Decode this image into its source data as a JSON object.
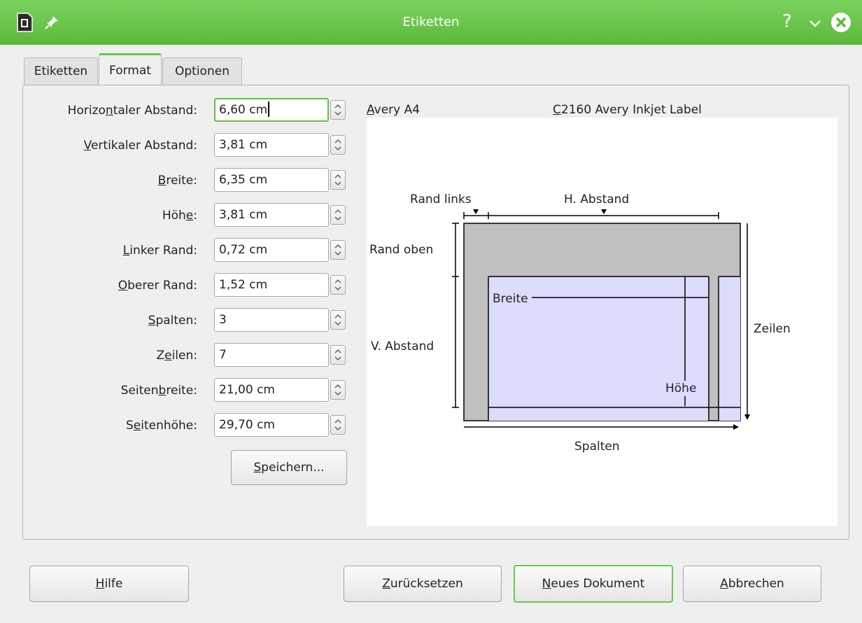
{
  "window": {
    "title": "Etiketten",
    "help": "?"
  },
  "tabs": [
    {
      "label": "Etiketten"
    },
    {
      "label": "Format"
    },
    {
      "label": "Optionen"
    }
  ],
  "fields": [
    {
      "pre": "Horizo",
      "key": "n",
      "post": "taler Abstand:",
      "value": "6,60 cm"
    },
    {
      "pre": "",
      "key": "V",
      "post": "ertikaler Abstand:",
      "value": "3,81 cm"
    },
    {
      "pre": "",
      "key": "B",
      "post": "reite:",
      "value": "6,35 cm"
    },
    {
      "pre": "Höh",
      "key": "e",
      "post": ":",
      "value": "3,81 cm"
    },
    {
      "pre": "",
      "key": "L",
      "post": "inker Rand:",
      "value": "0,72 cm"
    },
    {
      "pre": "",
      "key": "O",
      "post": "berer Rand:",
      "value": "1,52 cm"
    },
    {
      "pre": "",
      "key": "S",
      "post": "palten:",
      "value": "3"
    },
    {
      "pre": "Z",
      "key": "e",
      "post": "ilen:",
      "value": "7"
    },
    {
      "pre": "Seiten",
      "key": "b",
      "post": "reite:",
      "value": "21,00 cm"
    },
    {
      "pre": "S",
      "key": "e",
      "post": "itenhöhe:",
      "value": "29,70 cm"
    }
  ],
  "save_button": {
    "key": "S",
    "post": "peichern..."
  },
  "header": {
    "make_key": "A",
    "make_rest": "very A4",
    "type_key": "C",
    "type_rest": "2160 Avery Inkjet Label"
  },
  "preview": {
    "rand_links": "Rand links",
    "h_abstand": "H. Abstand",
    "rand_oben": "Rand oben",
    "v_abstand": "V. Abstand",
    "breite": "Breite",
    "hoehe": "Höhe",
    "zeilen": "Zeilen",
    "spalten": "Spalten"
  },
  "buttons": {
    "help": {
      "key": "H",
      "post": "ilfe"
    },
    "reset": {
      "key": "Z",
      "post": "urücksetzen"
    },
    "new_doc": {
      "key": "N",
      "post": "eues Dokument"
    },
    "cancel": {
      "key": "A",
      "post": "bbrechen"
    }
  },
  "colors": {
    "titlebar": "#66c047",
    "accent": "#6cc64f",
    "label_fill": "#dcdcfc",
    "margin_fill": "#c0c0c0"
  }
}
